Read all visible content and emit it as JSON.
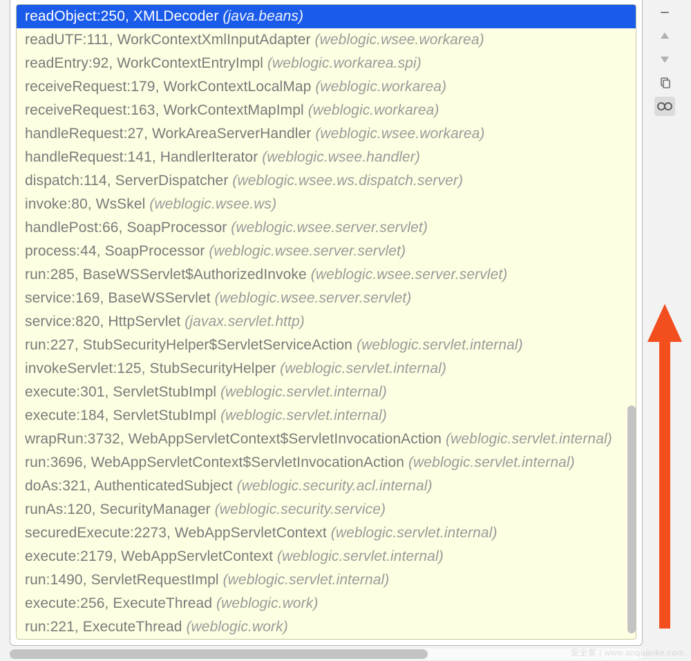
{
  "stack": {
    "selectedIndex": 0,
    "frames": [
      {
        "method": "readObject:250, XMLDecoder",
        "pkg": "(java.beans)"
      },
      {
        "method": "readUTF:111, WorkContextXmlInputAdapter",
        "pkg": "(weblogic.wsee.workarea)"
      },
      {
        "method": "readEntry:92, WorkContextEntryImpl",
        "pkg": "(weblogic.workarea.spi)"
      },
      {
        "method": "receiveRequest:179, WorkContextLocalMap",
        "pkg": "(weblogic.workarea)"
      },
      {
        "method": "receiveRequest:163, WorkContextMapImpl",
        "pkg": "(weblogic.workarea)"
      },
      {
        "method": "handleRequest:27, WorkAreaServerHandler",
        "pkg": "(weblogic.wsee.workarea)"
      },
      {
        "method": "handleRequest:141, HandlerIterator",
        "pkg": "(weblogic.wsee.handler)"
      },
      {
        "method": "dispatch:114, ServerDispatcher",
        "pkg": "(weblogic.wsee.ws.dispatch.server)"
      },
      {
        "method": "invoke:80, WsSkel",
        "pkg": "(weblogic.wsee.ws)"
      },
      {
        "method": "handlePost:66, SoapProcessor",
        "pkg": "(weblogic.wsee.server.servlet)"
      },
      {
        "method": "process:44, SoapProcessor",
        "pkg": "(weblogic.wsee.server.servlet)"
      },
      {
        "method": "run:285, BaseWSServlet$AuthorizedInvoke",
        "pkg": "(weblogic.wsee.server.servlet)"
      },
      {
        "method": "service:169, BaseWSServlet",
        "pkg": "(weblogic.wsee.server.servlet)"
      },
      {
        "method": "service:820, HttpServlet",
        "pkg": "(javax.servlet.http)"
      },
      {
        "method": "run:227, StubSecurityHelper$ServletServiceAction",
        "pkg": "(weblogic.servlet.internal)"
      },
      {
        "method": "invokeServlet:125, StubSecurityHelper",
        "pkg": "(weblogic.servlet.internal)"
      },
      {
        "method": "execute:301, ServletStubImpl",
        "pkg": "(weblogic.servlet.internal)"
      },
      {
        "method": "execute:184, ServletStubImpl",
        "pkg": "(weblogic.servlet.internal)"
      },
      {
        "method": "wrapRun:3732, WebAppServletContext$ServletInvocationAction",
        "pkg": "(weblogic.servlet.internal)"
      },
      {
        "method": "run:3696, WebAppServletContext$ServletInvocationAction",
        "pkg": "(weblogic.servlet.internal)"
      },
      {
        "method": "doAs:321, AuthenticatedSubject",
        "pkg": "(weblogic.security.acl.internal)"
      },
      {
        "method": "runAs:120, SecurityManager",
        "pkg": "(weblogic.security.service)"
      },
      {
        "method": "securedExecute:2273, WebAppServletContext",
        "pkg": "(weblogic.servlet.internal)"
      },
      {
        "method": "execute:2179, WebAppServletContext",
        "pkg": "(weblogic.servlet.internal)"
      },
      {
        "method": "run:1490, ServletRequestImpl",
        "pkg": "(weblogic.servlet.internal)"
      },
      {
        "method": "execute:256, ExecuteThread",
        "pkg": "(weblogic.work)"
      },
      {
        "method": "run:221, ExecuteThread",
        "pkg": "(weblogic.work)"
      }
    ]
  },
  "gutter": {
    "icons": [
      "dash",
      "arrow-up",
      "arrow-down",
      "copy",
      "glasses"
    ]
  },
  "watermark": "安全客 | www.anquanke.com",
  "colors": {
    "selectionBg": "#1A5BEA",
    "panelBg": "#FEFEE2",
    "arrow": "#F24E1E"
  }
}
